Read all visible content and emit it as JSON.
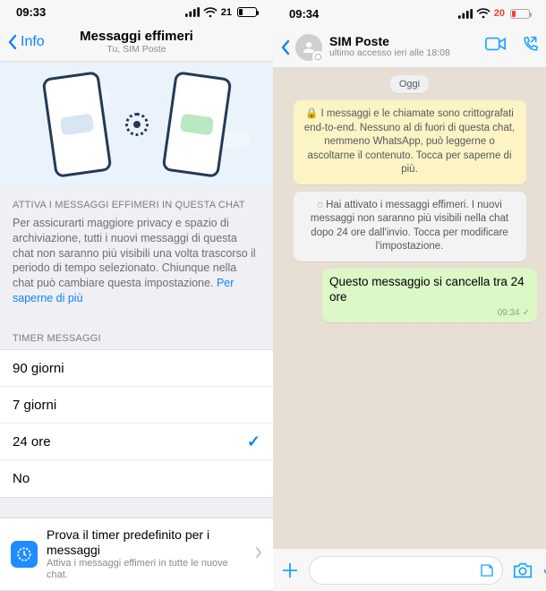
{
  "left": {
    "status": {
      "time": "09:33",
      "battery_pct": 21
    },
    "nav": {
      "back": "Info",
      "title": "Messaggi effimeri",
      "subtitle": "Tu, SIM Poste"
    },
    "sectionA": {
      "label": "ATTIVA I MESSAGGI EFFIMERI IN QUESTA CHAT",
      "desc": "Per assicurarti maggiore privacy e spazio di archiviazione, tutti i nuovi messaggi di questa chat non saranno più visibili una volta trascorso il periodo di tempo selezionato. Chiunque nella chat può cambiare questa impostazione.",
      "learn_more": "Per saperne di più"
    },
    "sectionB": {
      "label": "TIMER MESSAGGI"
    },
    "options": [
      {
        "label": "90 giorni",
        "selected": false
      },
      {
        "label": "7 giorni",
        "selected": false
      },
      {
        "label": "24 ore",
        "selected": true
      },
      {
        "label": "No",
        "selected": false
      }
    ],
    "promo": {
      "title": "Prova il timer predefinito per i messaggi",
      "subtitle": "Attiva i messaggi effimeri in tutte le nuove chat."
    }
  },
  "right": {
    "status": {
      "time": "09:34",
      "battery_pct": 20
    },
    "nav": {
      "title": "SIM Poste",
      "subtitle": "ultimo accesso ieri alle 18:08"
    },
    "date_pill": "Oggi",
    "encryption_notice": "I messaggi e le chiamate sono crittografati end-to-end. Nessuno al di fuori di questa chat, nemmeno WhatsApp, può leggerne o ascoltarne il contenuto. Tocca per saperne di più.",
    "dm_notice": "Hai attivato i messaggi effimeri. I nuovi messaggi non saranno più visibili nella chat dopo 24 ore dall'invio. Tocca per modificare l'impostazione.",
    "message": {
      "text": "Questo messaggio si cancella tra 24 ore",
      "time": "09:34"
    }
  }
}
